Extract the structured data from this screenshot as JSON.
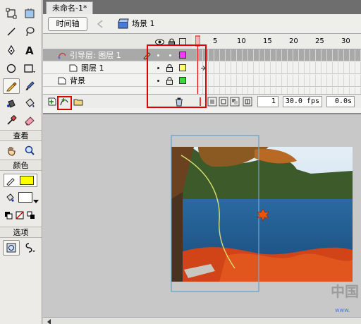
{
  "document": {
    "tab_title": "未命名-1*"
  },
  "edit_bar": {
    "timeline_label": "时间轴",
    "scene_label": "场景 1"
  },
  "tools": {
    "view_header": "查看",
    "colors_header": "颜色",
    "options_header": "选项",
    "stroke_color": "#000000",
    "fill_color": "#ffff00"
  },
  "timeline": {
    "frame_ticks": [
      "5",
      "10",
      "15",
      "20",
      "25",
      "30"
    ],
    "layers": [
      {
        "name": "引导层: 图层 1",
        "color": "#ff33ff",
        "selected": true,
        "type": "guide-layer-icon"
      },
      {
        "name": "图层 1",
        "color": "#ffff66",
        "selected": false,
        "type": "layer-icon"
      },
      {
        "name": "背景",
        "color": "#33dd33",
        "selected": false,
        "type": "layer-icon"
      }
    ],
    "current_frame": "1",
    "frame_rate": "30.0 fps",
    "elapsed_time": "0.0s"
  },
  "watermark": {
    "text": "中国",
    "url": "www."
  }
}
